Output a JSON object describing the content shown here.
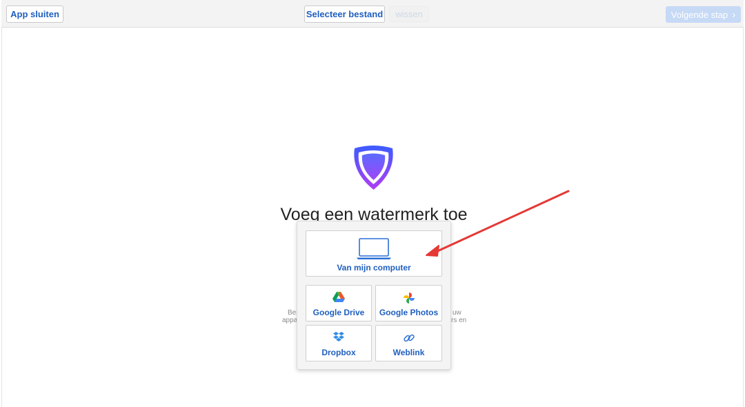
{
  "toolbar": {
    "close_label": "App sluiten",
    "select_label": "Selecteer bestand",
    "clear_label": "wissen",
    "next_label": "Volgende stap",
    "next_icon": "chevron-right-icon"
  },
  "main": {
    "logo": "shield-logo",
    "title": "Voeg een watermerk toe",
    "background_text": {
      "left_line_1": "Bes",
      "left_line_2": "appa",
      "right_line_1": "uw",
      "right_line_2": "rs en"
    }
  },
  "source_menu": {
    "computer_label": "Van mijn computer",
    "drive_label": "Google Drive",
    "photos_label": "Google Photos",
    "dropbox_label": "Dropbox",
    "weblink_label": "Weblink"
  },
  "colors": {
    "accent": "#1f5fbf",
    "disabled_button": "#c6d9f5",
    "annotation_arrow": "#e53935",
    "shield_top": "#3b5cff",
    "shield_bottom": "#b13df5"
  }
}
